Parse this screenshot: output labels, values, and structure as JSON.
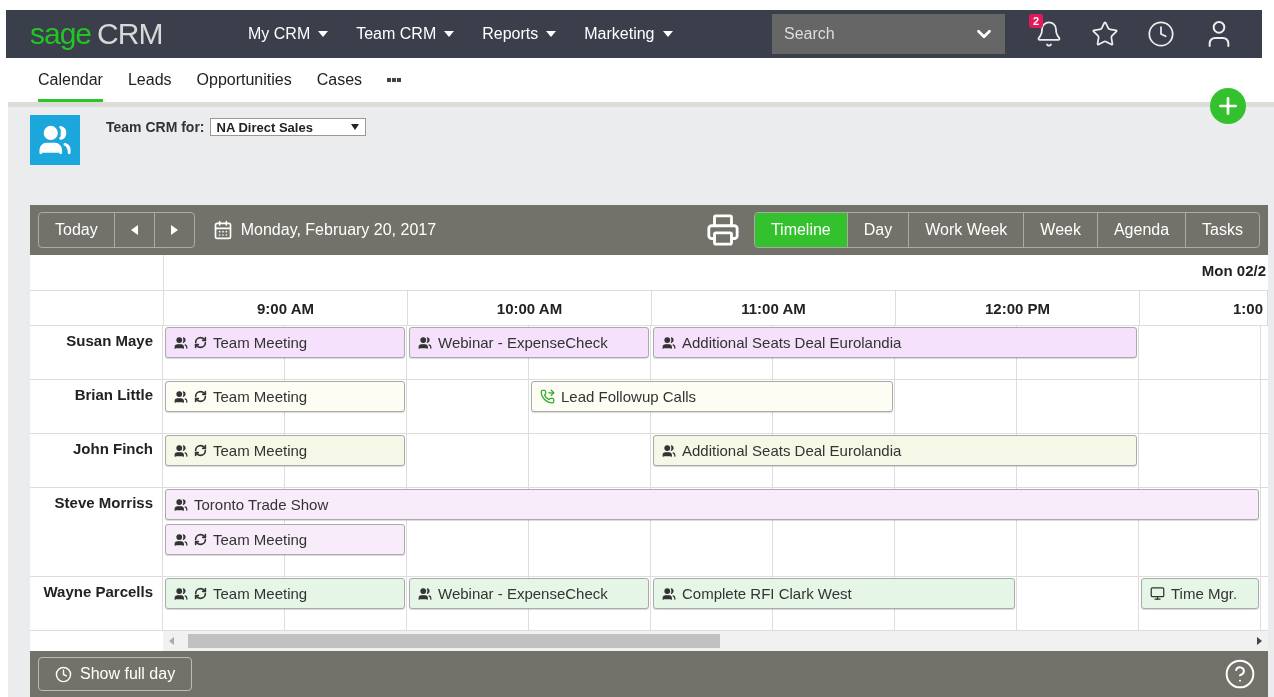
{
  "header": {
    "logo": {
      "brand": "sage",
      "product": "CRM"
    },
    "menu": [
      {
        "label": "My CRM"
      },
      {
        "label": "Team CRM"
      },
      {
        "label": "Reports"
      },
      {
        "label": "Marketing"
      }
    ],
    "search": {
      "placeholder": "Search"
    },
    "notifications": {
      "badge": "2"
    }
  },
  "tabs": [
    {
      "label": "Calendar",
      "selected": true
    },
    {
      "label": "Leads",
      "selected": false
    },
    {
      "label": "Opportunities",
      "selected": false
    },
    {
      "label": "Cases",
      "selected": false
    }
  ],
  "team_selector": {
    "label": "Team CRM for:",
    "value": "NA Direct Sales"
  },
  "toolbar": {
    "today": "Today",
    "date": "Monday, February 20, 2017",
    "views": [
      {
        "label": "Timeline",
        "selected": true
      },
      {
        "label": "Day",
        "selected": false
      },
      {
        "label": "Work Week",
        "selected": false
      },
      {
        "label": "Week",
        "selected": false
      },
      {
        "label": "Agenda",
        "selected": false
      },
      {
        "label": "Tasks",
        "selected": false
      }
    ]
  },
  "timeline": {
    "date_header": "Mon 02/2",
    "hours": [
      "9:00 AM",
      "10:00 AM",
      "11:00 AM",
      "12:00 PM",
      "1:00"
    ],
    "rows": [
      {
        "name": "Susan Maye",
        "lanes": [
          [
            {
              "kind": "meeting",
              "title": "Team Meeting",
              "recurring": true,
              "color": "#f5e1fb"
            },
            {
              "kind": "more"
            },
            {
              "kind": "meeting",
              "title": "Webinar - ExpenseCheck",
              "recurring": false,
              "color": "#f5e1fb"
            },
            {
              "kind": "more"
            },
            {
              "kind": "meeting",
              "title": "Additional Seats Deal Eurolandia",
              "recurring": false,
              "color": "#f5e1fb"
            },
            {
              "kind": "more"
            },
            {
              "kind": "more"
            },
            {
              "kind": "more"
            },
            {
              "kind": "empty"
            }
          ]
        ]
      },
      {
        "name": "Brian Little",
        "lanes": [
          [
            {
              "kind": "meeting",
              "title": "Team Meeting",
              "recurring": true,
              "color": "#fdfdf3"
            },
            {
              "kind": "more"
            },
            {
              "kind": "empty"
            },
            {
              "kind": "call",
              "title": "Lead Followup Calls",
              "recurring": false,
              "color": "#fdfdf3"
            },
            {
              "kind": "more"
            },
            {
              "kind": "more"
            },
            {
              "kind": "empty"
            },
            {
              "kind": "empty"
            },
            {
              "kind": "empty"
            }
          ]
        ]
      },
      {
        "name": "John Finch",
        "lanes": [
          [
            {
              "kind": "meeting",
              "title": "Team Meeting",
              "recurring": true,
              "color": "#f5f8e6"
            },
            {
              "kind": "more"
            },
            {
              "kind": "empty"
            },
            {
              "kind": "empty"
            },
            {
              "kind": "meeting",
              "title": "Additional Seats Deal Eurolandia",
              "recurring": false,
              "color": "#f5f8e6"
            },
            {
              "kind": "more"
            },
            {
              "kind": "more"
            },
            {
              "kind": "more"
            },
            {
              "kind": "empty"
            }
          ]
        ]
      },
      {
        "name": "Steve Morriss",
        "lanes": [
          [
            {
              "kind": "meeting",
              "title": "Toronto Trade Show",
              "recurring": false,
              "color": "#f8ecfb"
            },
            {
              "kind": "more"
            },
            {
              "kind": "more"
            },
            {
              "kind": "more"
            },
            {
              "kind": "more"
            },
            {
              "kind": "more"
            },
            {
              "kind": "more"
            },
            {
              "kind": "more"
            },
            {
              "kind": "more"
            }
          ],
          [
            {
              "kind": "meeting",
              "title": "Team Meeting",
              "recurring": true,
              "color": "#f8ecfb"
            },
            {
              "kind": "more"
            },
            {
              "kind": "empty"
            },
            {
              "kind": "empty"
            },
            {
              "kind": "empty"
            },
            {
              "kind": "empty"
            },
            {
              "kind": "empty"
            },
            {
              "kind": "empty"
            },
            {
              "kind": "empty"
            }
          ]
        ]
      },
      {
        "name": "Wayne Parcells",
        "lanes": [
          [
            {
              "kind": "meeting",
              "title": "Team Meeting",
              "recurring": true,
              "color": "#e6f6e6"
            },
            {
              "kind": "more"
            },
            {
              "kind": "meeting",
              "title": "Webinar - ExpenseCheck",
              "recurring": false,
              "color": "#e6f6e6"
            },
            {
              "kind": "more"
            },
            {
              "kind": "meeting",
              "title": "Complete RFI Clark West",
              "recurring": false,
              "color": "#e6f6e6"
            },
            {
              "kind": "more"
            },
            {
              "kind": "more"
            },
            {
              "kind": "empty"
            },
            {
              "kind": "task",
              "title": "Time Mgr.",
              "recurring": false,
              "color": "#e6f6e6"
            }
          ]
        ]
      }
    ]
  },
  "footer": {
    "show_full_day": "Show full day"
  }
}
